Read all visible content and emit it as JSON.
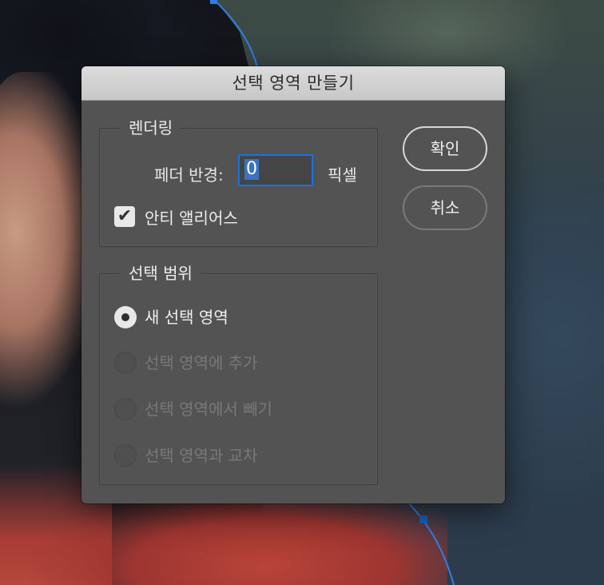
{
  "dialog": {
    "title": "선택 영역 만들기",
    "rendering": {
      "legend": "렌더링",
      "feather_label": "페더 반경:",
      "feather_value": "0",
      "feather_unit": "픽셀",
      "anti_alias_label": "안티 앨리어스",
      "anti_alias_checked": true
    },
    "selection_range": {
      "legend": "선택 범위",
      "options": [
        {
          "label": "새 선택 영역",
          "selected": true,
          "enabled": true
        },
        {
          "label": "선택 영역에 추가",
          "selected": false,
          "enabled": false
        },
        {
          "label": "선택 영역에서 빼기",
          "selected": false,
          "enabled": false
        },
        {
          "label": "선택 영역과 교차",
          "selected": false,
          "enabled": false
        }
      ]
    },
    "buttons": {
      "ok_label": "확인",
      "cancel_label": "취소"
    }
  },
  "colors": {
    "dialog_bg": "#535353",
    "accent_blue": "#1473e6",
    "path_blue": "#2f7ee6"
  }
}
